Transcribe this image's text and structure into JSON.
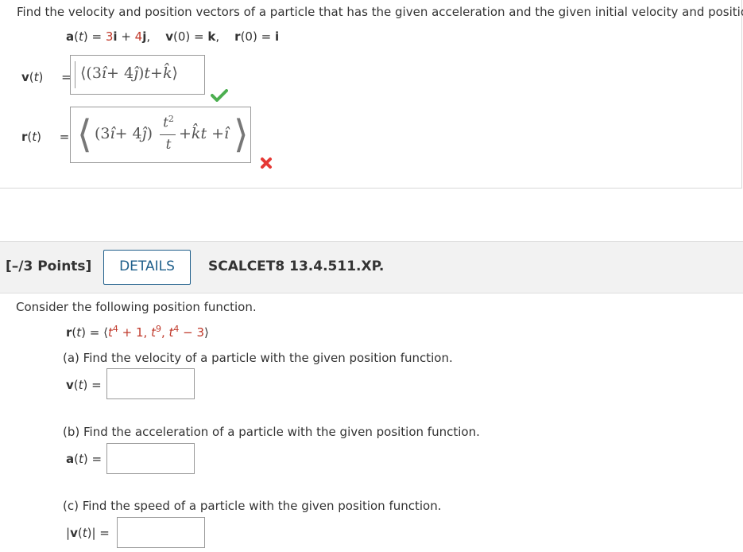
{
  "q1": {
    "prompt": "Find the velocity and position vectors of a particle that has the given acceleration and the given initial velocity and position.",
    "given": {
      "a_label": "a",
      "a_rhs_1": "3",
      "a_i": "i",
      "a_plus": " + ",
      "a_rhs_2": "4",
      "a_j": "j",
      "v0_label": "v",
      "v0_rhs": "k",
      "r0_label": "r",
      "r0_rhs": "i"
    },
    "v_row": {
      "label": "v",
      "var": "t",
      "answer_tokens": [
        "⟨(3",
        "î",
        " + 4",
        "ĵ",
        ")",
        "t",
        " + ",
        "k̂",
        "⟩"
      ],
      "status": "correct"
    },
    "r_row": {
      "label": "r",
      "var": "t",
      "answer_tokens": [
        "(3",
        "î",
        " + 4",
        "ĵ",
        ")"
      ],
      "frac_num": "t",
      "frac_sup": "2",
      "frac_den": "t",
      "tail_tokens": [
        " + ",
        "k̂",
        "t + ",
        "î"
      ],
      "status": "incorrect"
    },
    "icons": {
      "correct": "check-icon",
      "incorrect": "cross-icon"
    },
    "colors": {
      "check": "#4caf50",
      "cross": "#e53935",
      "given_value": "#c0392b",
      "link": "#1f5f8b"
    }
  },
  "q2": {
    "points": "[–/3 Points]",
    "details_label": "DETAILS",
    "code": "SCALCET8 13.4.511.XP.",
    "intro": "Consider the following position function.",
    "r_label": "r",
    "r_var": "t",
    "r_open": "⟨",
    "r_c1": "t",
    "r_c1_exp": "4",
    "r_c1_tail": " + 1, ",
    "r_c2": "t",
    "r_c2_exp": "9",
    "r_c2_tail": ", ",
    "r_c3": "t",
    "r_c3_exp": "4",
    "r_c3_tail": " − 3",
    "r_close": "⟩",
    "parts": [
      {
        "text": "(a) Find the velocity of a particle with the given position function.",
        "label": "v",
        "var": "t",
        "value": ""
      },
      {
        "text": "(b) Find the acceleration of a particle with the given position function.",
        "label": "a",
        "var": "t",
        "value": ""
      },
      {
        "text": "(c) Find the speed of a particle with the given position function.",
        "label": "v",
        "var": "t",
        "value": ""
      }
    ]
  }
}
